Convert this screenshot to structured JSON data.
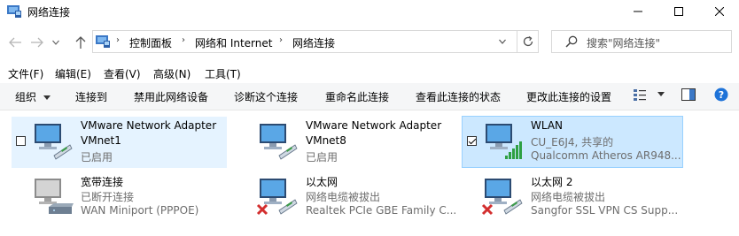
{
  "window": {
    "title": "网络连接",
    "buttons": [
      "minimize",
      "maximize",
      "close"
    ]
  },
  "address_bar": {
    "breadcrumbs": [
      "控制面板",
      "网络和 Internet",
      "网络连接"
    ]
  },
  "search": {
    "placeholder": "搜索\"网络连接\""
  },
  "menu_bar": [
    "文件(F)",
    "编辑(E)",
    "查看(V)",
    "高级(N)",
    "工具(T)"
  ],
  "command_bar": {
    "organize": "组织",
    "items": [
      "连接到",
      "禁用此网络设备",
      "诊断这个连接",
      "重命名此连接",
      "查看此连接的状态",
      "更改此连接的设置"
    ]
  },
  "connections": [
    {
      "name": "VMware Network Adapter",
      "line2": "VMnet1",
      "line3": "已启用",
      "state": "hover",
      "checkbox": "unchecked",
      "icon": "network-adapter-icon"
    },
    {
      "name": "VMware Network Adapter",
      "line2": "VMnet8",
      "line3": "已启用",
      "state": "normal",
      "icon": "network-adapter-icon"
    },
    {
      "name": "WLAN",
      "line2": "CU_E6J4, 共享的",
      "line3": "Qualcomm Atheros AR948...",
      "state": "selected",
      "checkbox": "checked",
      "icon": "wifi-signal-icon"
    },
    {
      "name": "宽带连接",
      "line2": "已断开连接",
      "line3": "WAN Miniport (PPPOE)",
      "state": "normal",
      "icon": "broadband-modem-icon"
    },
    {
      "name": "以太网",
      "line2": "网络电缆被拔出",
      "line3": "Realtek PCIe GBE Family C...",
      "state": "normal",
      "icon": "ethernet-disconnected-icon"
    },
    {
      "name": "以太网 2",
      "line2": "网络电缆被拔出",
      "line3": "Sangfor SSL VPN CS Supp...",
      "state": "normal",
      "icon": "ethernet-disconnected-icon"
    }
  ],
  "colors": {
    "hover_bg": "#e5f3ff",
    "selected_bg": "#cce8ff",
    "selected_border": "#99d1ff",
    "command_bar_bg": "#f5f6f7",
    "error_red": "#d32f2f",
    "signal_green": "#2ea043"
  }
}
